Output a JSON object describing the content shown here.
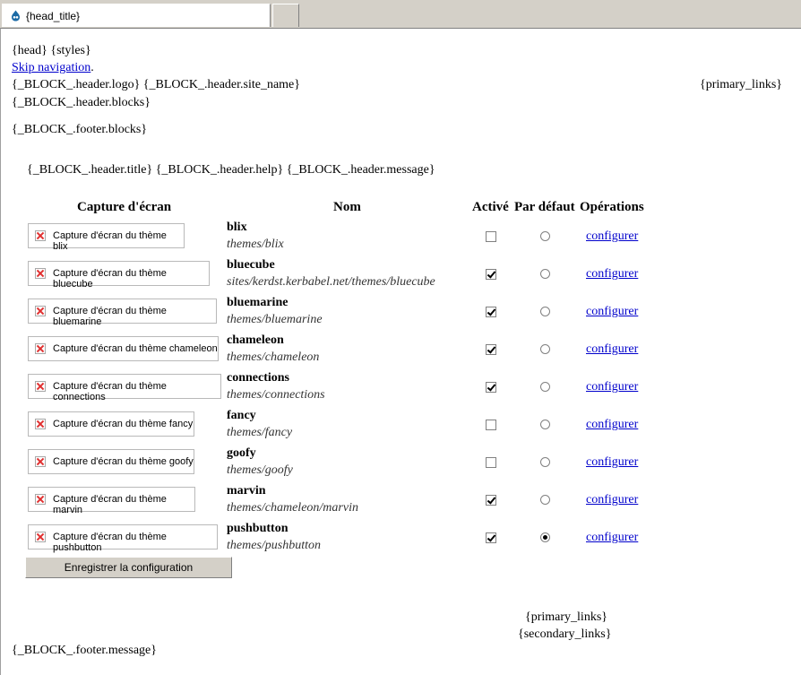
{
  "tabs": [
    {
      "label": "{head_title}",
      "icon": "drupal-drop-icon"
    },
    {
      "label": ""
    }
  ],
  "page": {
    "head_styles": "{head}  {styles}",
    "skip_navigation": "Skip navigation",
    "skip_navigation_suffix": ".",
    "header_logo_site_name": "{_BLOCK_.header.logo} {_BLOCK_.header.site_name}",
    "primary_links_top": "{primary_links}",
    "header_blocks": "{_BLOCK_.header.blocks}",
    "footer_blocks": "{_BLOCK_.footer.blocks}",
    "header_title_help_message": "{_BLOCK_.header.title}  {_BLOCK_.header.help}  {_BLOCK_.header.message}"
  },
  "table": {
    "headers": {
      "screenshot": "Capture d'écran",
      "name": "Nom",
      "enabled": "Activé",
      "default": "Par défaut",
      "operations": "Opérations"
    },
    "rows": [
      {
        "screenshot_alt": "Capture d'écran du thème blix",
        "name": "blix",
        "path": "themes/blix",
        "enabled": false,
        "default": false,
        "operation": "configurer"
      },
      {
        "screenshot_alt": "Capture d'écran du thème bluecube",
        "name": "bluecube",
        "path": "sites/kerdst.kerbabel.net/themes/bluecube",
        "enabled": true,
        "default": false,
        "operation": "configurer"
      },
      {
        "screenshot_alt": "Capture d'écran du thème bluemarine",
        "name": "bluemarine",
        "path": "themes/bluemarine",
        "enabled": true,
        "default": false,
        "operation": "configurer"
      },
      {
        "screenshot_alt": "Capture d'écran du thème chameleon",
        "name": "chameleon",
        "path": "themes/chameleon",
        "enabled": true,
        "default": false,
        "operation": "configurer"
      },
      {
        "screenshot_alt": "Capture d'écran du thème connections",
        "name": "connections",
        "path": "themes/connections",
        "enabled": true,
        "default": false,
        "operation": "configurer"
      },
      {
        "screenshot_alt": "Capture d'écran du thème fancy",
        "name": "fancy",
        "path": "themes/fancy",
        "enabled": false,
        "default": false,
        "operation": "configurer"
      },
      {
        "screenshot_alt": "Capture d'écran du thème goofy",
        "name": "goofy",
        "path": "themes/goofy",
        "enabled": false,
        "default": false,
        "operation": "configurer"
      },
      {
        "screenshot_alt": "Capture d'écran du thème marvin",
        "name": "marvin",
        "path": "themes/chameleon/marvin",
        "enabled": true,
        "default": false,
        "operation": "configurer"
      },
      {
        "screenshot_alt": "Capture d'écran du thème pushbutton",
        "name": "pushbutton",
        "path": "themes/pushbutton",
        "enabled": true,
        "default": true,
        "operation": "configurer"
      }
    ]
  },
  "save_button": "Enregistrer la configuration",
  "footer": {
    "primary_links": "{primary_links}",
    "secondary_links": "{secondary_links}",
    "footer_message": "{_BLOCK_.footer.message}"
  },
  "colors": {
    "link": "#0000cc",
    "broken_image_x": "#e03030"
  }
}
